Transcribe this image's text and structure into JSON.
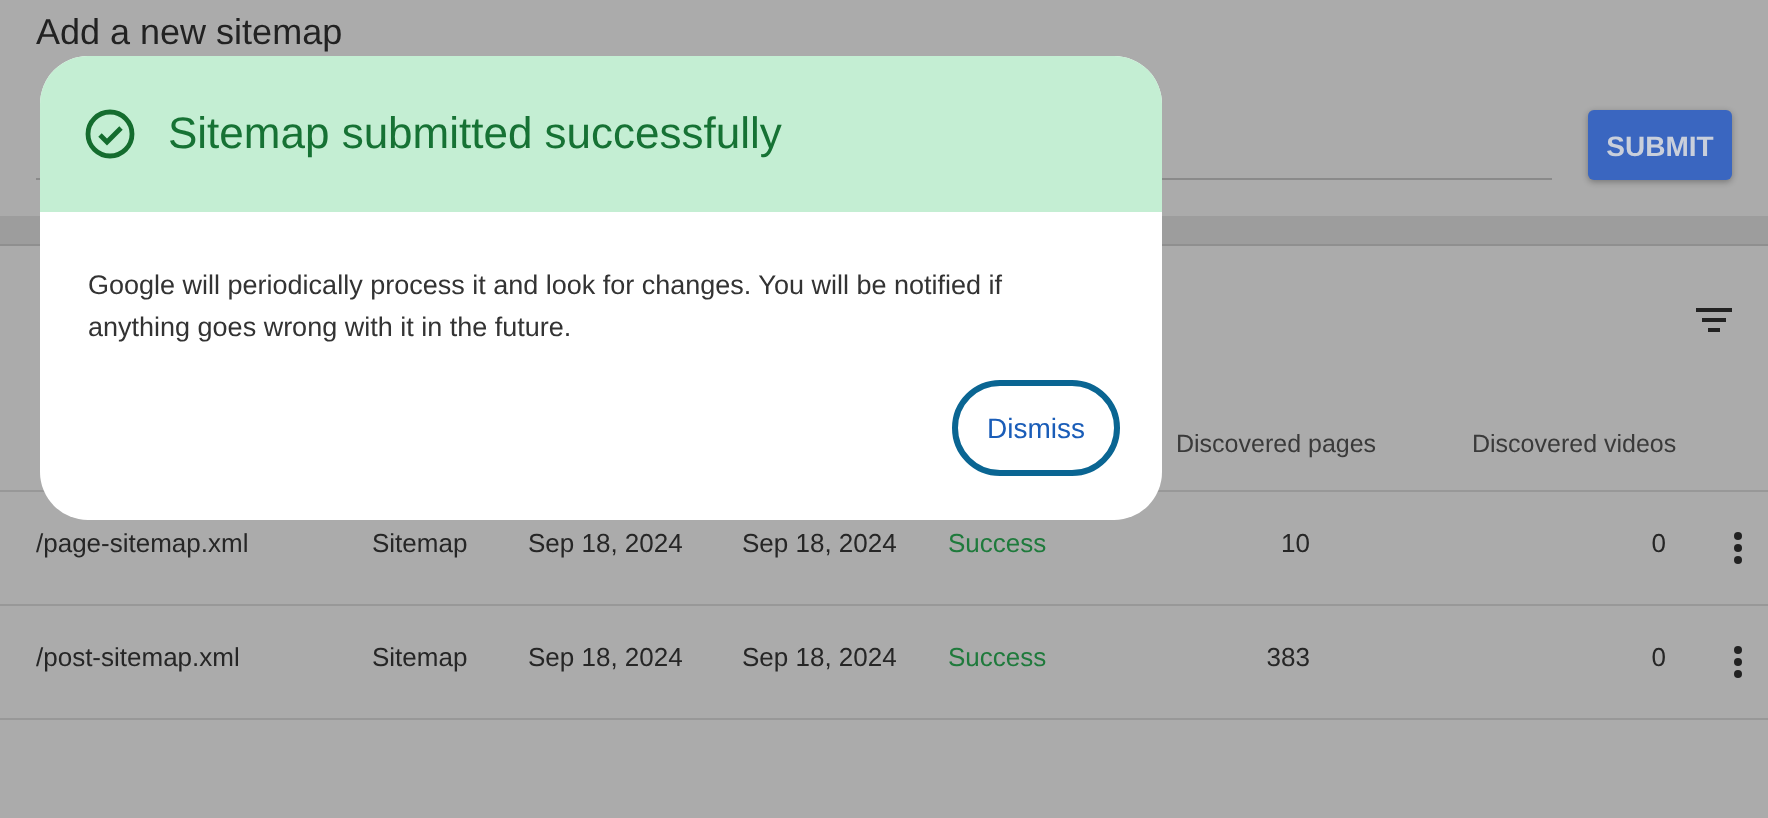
{
  "page": {
    "title": "Add a new sitemap",
    "submit_button": "SUBMIT"
  },
  "table": {
    "columns": [
      "Discovered pages",
      "Discovered videos"
    ],
    "rows": [
      {
        "sitemap": "/page-sitemap.xml",
        "type": "Sitemap",
        "submitted": "Sep 18, 2024",
        "last_read": "Sep 18, 2024",
        "status": "Success",
        "discovered_pages": "10",
        "discovered_videos": "0"
      },
      {
        "sitemap": "/post-sitemap.xml",
        "type": "Sitemap",
        "submitted": "Sep 18, 2024",
        "last_read": "Sep 18, 2024",
        "status": "Success",
        "discovered_pages": "383",
        "discovered_videos": "0"
      }
    ]
  },
  "dialog": {
    "title": "Sitemap submitted successfully",
    "message": "Google will periodically process it and look for changes. You will be notified if anything goes wrong with it in the future.",
    "button": "Dismiss"
  }
}
